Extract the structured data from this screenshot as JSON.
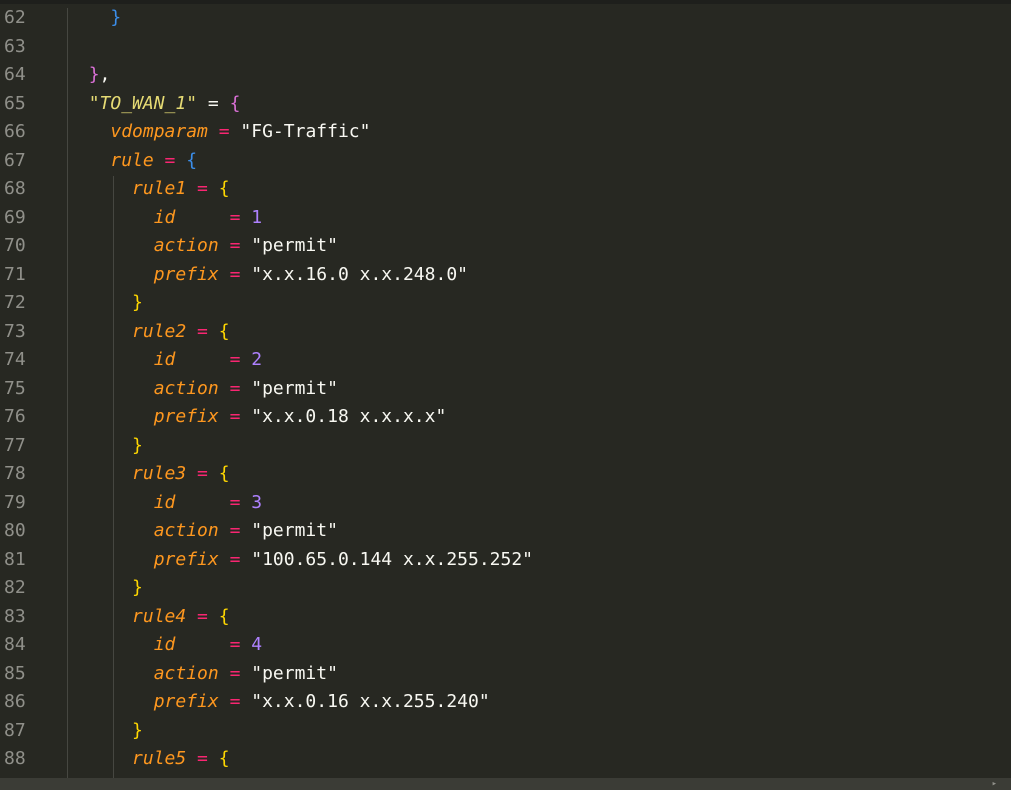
{
  "editor": {
    "lines": [
      {
        "n": "62",
        "tokens": [
          {
            "t": "    ",
            "c": "tok-str"
          },
          {
            "t": "}",
            "c": "tok-brace-blue"
          }
        ]
      },
      {
        "n": "63",
        "tokens": []
      },
      {
        "n": "64",
        "tokens": [
          {
            "t": "  ",
            "c": "tok-str"
          },
          {
            "t": "}",
            "c": "tok-brace-pink"
          },
          {
            "t": ",",
            "c": "tok-punct"
          }
        ]
      },
      {
        "n": "65",
        "tokens": [
          {
            "t": "  ",
            "c": "tok-str"
          },
          {
            "t": "\"TO_WAN_1\"",
            "c": "tok-key-str"
          },
          {
            "t": " = ",
            "c": "tok-op-plain"
          },
          {
            "t": "{",
            "c": "tok-brace-pink"
          }
        ]
      },
      {
        "n": "66",
        "tokens": [
          {
            "t": "    ",
            "c": "tok-str"
          },
          {
            "t": "vdomparam",
            "c": "tok-key"
          },
          {
            "t": " = ",
            "c": "tok-op"
          },
          {
            "t": "\"FG-Traffic\"",
            "c": "tok-str"
          }
        ]
      },
      {
        "n": "67",
        "tokens": [
          {
            "t": "    ",
            "c": "tok-str"
          },
          {
            "t": "rule",
            "c": "tok-key"
          },
          {
            "t": " = ",
            "c": "tok-op"
          },
          {
            "t": "{",
            "c": "tok-brace-blue"
          }
        ]
      },
      {
        "n": "68",
        "tokens": [
          {
            "t": "      ",
            "c": "tok-str"
          },
          {
            "t": "rule1",
            "c": "tok-key"
          },
          {
            "t": " = ",
            "c": "tok-op"
          },
          {
            "t": "{",
            "c": "tok-brace-yellow"
          }
        ]
      },
      {
        "n": "69",
        "tokens": [
          {
            "t": "        ",
            "c": "tok-str"
          },
          {
            "t": "id",
            "c": "tok-key"
          },
          {
            "t": "     = ",
            "c": "tok-op"
          },
          {
            "t": "1",
            "c": "tok-num"
          }
        ]
      },
      {
        "n": "70",
        "tokens": [
          {
            "t": "        ",
            "c": "tok-str"
          },
          {
            "t": "action",
            "c": "tok-key"
          },
          {
            "t": " = ",
            "c": "tok-op"
          },
          {
            "t": "\"permit\"",
            "c": "tok-str"
          }
        ]
      },
      {
        "n": "71",
        "tokens": [
          {
            "t": "        ",
            "c": "tok-str"
          },
          {
            "t": "prefix",
            "c": "tok-key"
          },
          {
            "t": " = ",
            "c": "tok-op"
          },
          {
            "t": "\"x.x.16.0 x.x.248.0\"",
            "c": "tok-str"
          }
        ]
      },
      {
        "n": "72",
        "tokens": [
          {
            "t": "      ",
            "c": "tok-str"
          },
          {
            "t": "}",
            "c": "tok-brace-yellow"
          }
        ]
      },
      {
        "n": "73",
        "tokens": [
          {
            "t": "      ",
            "c": "tok-str"
          },
          {
            "t": "rule2",
            "c": "tok-key"
          },
          {
            "t": " = ",
            "c": "tok-op"
          },
          {
            "t": "{",
            "c": "tok-brace-yellow"
          }
        ]
      },
      {
        "n": "74",
        "tokens": [
          {
            "t": "        ",
            "c": "tok-str"
          },
          {
            "t": "id",
            "c": "tok-key"
          },
          {
            "t": "     = ",
            "c": "tok-op"
          },
          {
            "t": "2",
            "c": "tok-num"
          }
        ]
      },
      {
        "n": "75",
        "tokens": [
          {
            "t": "        ",
            "c": "tok-str"
          },
          {
            "t": "action",
            "c": "tok-key"
          },
          {
            "t": " = ",
            "c": "tok-op"
          },
          {
            "t": "\"permit\"",
            "c": "tok-str"
          }
        ]
      },
      {
        "n": "76",
        "tokens": [
          {
            "t": "        ",
            "c": "tok-str"
          },
          {
            "t": "prefix",
            "c": "tok-key"
          },
          {
            "t": " = ",
            "c": "tok-op"
          },
          {
            "t": "\"x.x.0.18 x.x.x.x\"",
            "c": "tok-str"
          }
        ]
      },
      {
        "n": "77",
        "tokens": [
          {
            "t": "      ",
            "c": "tok-str"
          },
          {
            "t": "}",
            "c": "tok-brace-yellow"
          }
        ]
      },
      {
        "n": "78",
        "tokens": [
          {
            "t": "      ",
            "c": "tok-str"
          },
          {
            "t": "rule3",
            "c": "tok-key"
          },
          {
            "t": " = ",
            "c": "tok-op"
          },
          {
            "t": "{",
            "c": "tok-brace-yellow"
          }
        ]
      },
      {
        "n": "79",
        "tokens": [
          {
            "t": "        ",
            "c": "tok-str"
          },
          {
            "t": "id",
            "c": "tok-key"
          },
          {
            "t": "     = ",
            "c": "tok-op"
          },
          {
            "t": "3",
            "c": "tok-num"
          }
        ]
      },
      {
        "n": "80",
        "tokens": [
          {
            "t": "        ",
            "c": "tok-str"
          },
          {
            "t": "action",
            "c": "tok-key"
          },
          {
            "t": " = ",
            "c": "tok-op"
          },
          {
            "t": "\"permit\"",
            "c": "tok-str"
          }
        ]
      },
      {
        "n": "81",
        "tokens": [
          {
            "t": "        ",
            "c": "tok-str"
          },
          {
            "t": "prefix",
            "c": "tok-key"
          },
          {
            "t": " = ",
            "c": "tok-op"
          },
          {
            "t": "\"100.65.0.144 x.x.255.252\"",
            "c": "tok-str"
          }
        ]
      },
      {
        "n": "82",
        "tokens": [
          {
            "t": "      ",
            "c": "tok-str"
          },
          {
            "t": "}",
            "c": "tok-brace-yellow"
          }
        ]
      },
      {
        "n": "83",
        "tokens": [
          {
            "t": "      ",
            "c": "tok-str"
          },
          {
            "t": "rule4",
            "c": "tok-key"
          },
          {
            "t": " = ",
            "c": "tok-op"
          },
          {
            "t": "{",
            "c": "tok-brace-yellow"
          }
        ]
      },
      {
        "n": "84",
        "tokens": [
          {
            "t": "        ",
            "c": "tok-str"
          },
          {
            "t": "id",
            "c": "tok-key"
          },
          {
            "t": "     = ",
            "c": "tok-op"
          },
          {
            "t": "4",
            "c": "tok-num"
          }
        ]
      },
      {
        "n": "85",
        "tokens": [
          {
            "t": "        ",
            "c": "tok-str"
          },
          {
            "t": "action",
            "c": "tok-key"
          },
          {
            "t": " = ",
            "c": "tok-op"
          },
          {
            "t": "\"permit\"",
            "c": "tok-str"
          }
        ]
      },
      {
        "n": "86",
        "tokens": [
          {
            "t": "        ",
            "c": "tok-str"
          },
          {
            "t": "prefix",
            "c": "tok-key"
          },
          {
            "t": " = ",
            "c": "tok-op"
          },
          {
            "t": "\"x.x.0.16 x.x.255.240\"",
            "c": "tok-str"
          }
        ]
      },
      {
        "n": "87",
        "tokens": [
          {
            "t": "      ",
            "c": "tok-str"
          },
          {
            "t": "}",
            "c": "tok-brace-yellow"
          }
        ]
      },
      {
        "n": "88",
        "tokens": [
          {
            "t": "      ",
            "c": "tok-str"
          },
          {
            "t": "rule5",
            "c": "tok-key"
          },
          {
            "t": " = ",
            "c": "tok-op"
          },
          {
            "t": "{",
            "c": "tok-brace-yellow"
          }
        ]
      }
    ]
  },
  "colors": {
    "background": "#272822",
    "line_number": "#90908a",
    "key": "#fd971f",
    "operator": "#f92672",
    "number": "#ae81ff",
    "string": "#f8f8f2"
  }
}
